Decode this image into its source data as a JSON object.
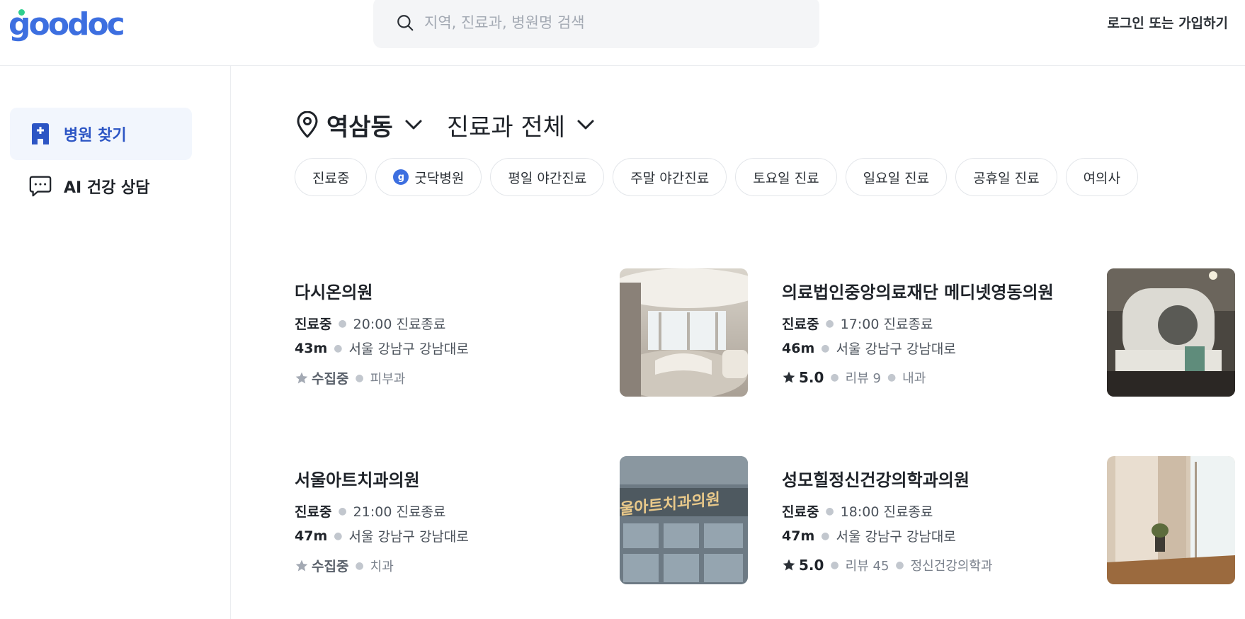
{
  "header": {
    "logo": "goodoc",
    "search_placeholder": "지역, 진료과, 병원명 검색",
    "login_label": "로그인 또는 가입하기"
  },
  "sidebar": {
    "items": [
      {
        "label": "병원 찾기",
        "icon": "hospital-icon",
        "active": true
      },
      {
        "label": "AI 건강 상담",
        "icon": "chat-icon",
        "active": false
      }
    ]
  },
  "filters": {
    "location": "역삼동",
    "department": "진료과 전체",
    "chips": [
      {
        "label": "진료중"
      },
      {
        "label": "굿닥병원",
        "badge": "g"
      },
      {
        "label": "평일 야간진료"
      },
      {
        "label": "주말 야간진료"
      },
      {
        "label": "토요일 진료"
      },
      {
        "label": "일요일 진료"
      },
      {
        "label": "공휴일 진료"
      },
      {
        "label": "여의사"
      }
    ]
  },
  "hospitals": [
    {
      "name": "다시온의원",
      "status": "진료중",
      "hours": "20:00 진료종료",
      "distance": "43m",
      "address": "서울 강남구 강남대로",
      "rating": "수집중",
      "reviews": "",
      "department": "피부과",
      "image": "clinic-lobby"
    },
    {
      "name": "의료법인중앙의료재단 메디넷영동의원",
      "status": "진료중",
      "hours": "17:00 진료종료",
      "distance": "46m",
      "address": "서울 강남구 강남대로",
      "rating": "5.0",
      "reviews": "리뷰 9",
      "department": "내과",
      "image": "mri-machine"
    },
    {
      "name": "서울아트치과의원",
      "status": "진료중",
      "hours": "21:00 진료종료",
      "distance": "47m",
      "address": "서울 강남구 강남대로",
      "rating": "수집중",
      "reviews": "",
      "department": "치과",
      "image": "building-sign",
      "sign_text": "울아트치과의원"
    },
    {
      "name": "성모힐정신건강의학과의원",
      "status": "진료중",
      "hours": "18:00 진료종료",
      "distance": "47m",
      "address": "서울 강남구 강남대로",
      "rating": "5.0",
      "reviews": "리뷰 45",
      "department": "정신건강의학과",
      "image": "clinic-corridor"
    }
  ]
}
